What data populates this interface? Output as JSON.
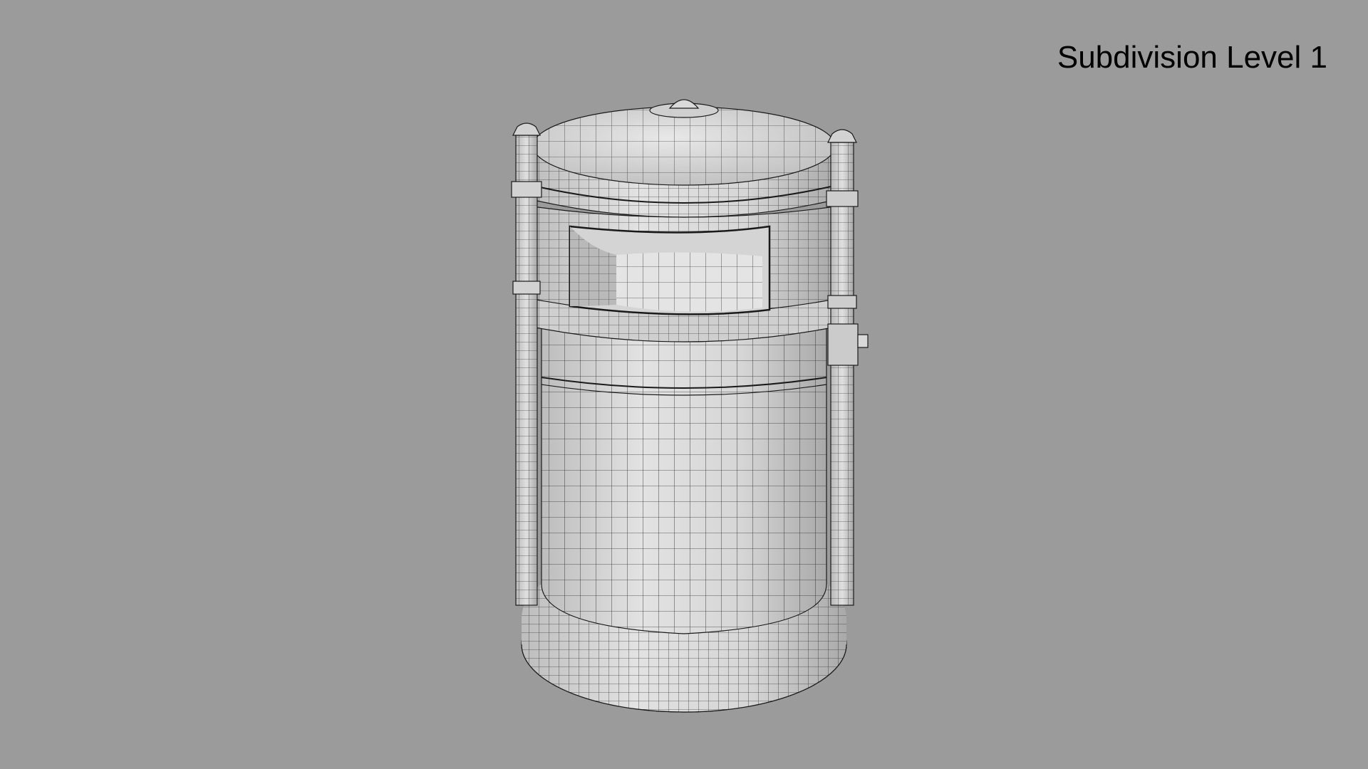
{
  "viewport": {
    "label": "Subdivision Level 1",
    "background_color": "#9b9b9b",
    "model_fill": "#dcdcdc",
    "wireframe_color": "#1a1a1a"
  }
}
